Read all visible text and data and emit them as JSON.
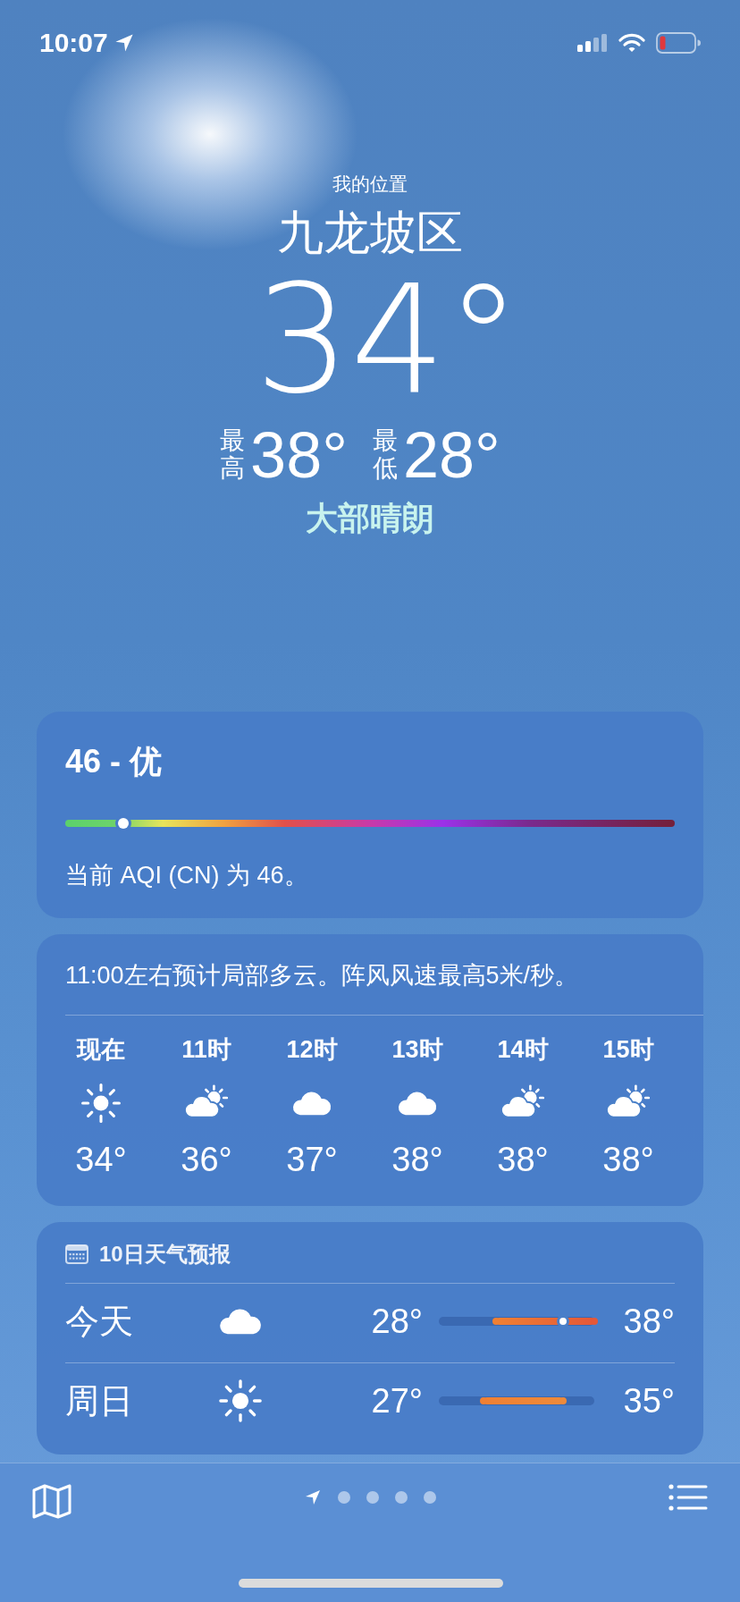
{
  "status_bar": {
    "time": "10:07"
  },
  "location": {
    "caption": "我的位置",
    "name": "九龙坡区",
    "temperature": "34°",
    "high_label": "最高",
    "high": "38°",
    "low_label": "最低",
    "low": "28°",
    "condition": "大部晴朗"
  },
  "aqi": {
    "title": "46 - 优",
    "level": 0.095,
    "description": "当前 AQI (CN) 为 46。"
  },
  "hourly": {
    "summary": "11:00左右预计局部多云。阵风风速最高5米/秒。",
    "hours": [
      {
        "label": "现在",
        "kind": "sun",
        "temp": "34°"
      },
      {
        "label": "11时",
        "kind": "partly-cloudy",
        "temp": "36°"
      },
      {
        "label": "12时",
        "kind": "cloud",
        "temp": "37°"
      },
      {
        "label": "13时",
        "kind": "cloud",
        "temp": "38°"
      },
      {
        "label": "14时",
        "kind": "partly-cloudy",
        "temp": "38°"
      },
      {
        "label": "15时",
        "kind": "partly-cloudy",
        "temp": "38°"
      }
    ]
  },
  "forecast": {
    "title": "10日天气预报",
    "days": [
      {
        "day": "今天",
        "kind": "cloud",
        "low": "28°",
        "high": "38°",
        "range": {
          "from": {
            "level": 0.37
          },
          "to": {
            "level": 1.0
          },
          "now": {
            "level": 0.78
          }
        }
      },
      {
        "day": "周日",
        "kind": "sun",
        "low": "27°",
        "high": "35°",
        "range": {
          "from": {
            "level": 0.29
          },
          "to": {
            "level": 0.8
          }
        }
      }
    ]
  },
  "pages": [
    {
      "kind": "location",
      "selected": true
    },
    {
      "kind": "dot",
      "selected": false
    },
    {
      "kind": "dot",
      "selected": false
    },
    {
      "kind": "dot",
      "selected": false
    },
    {
      "kind": "dot",
      "selected": false
    }
  ]
}
